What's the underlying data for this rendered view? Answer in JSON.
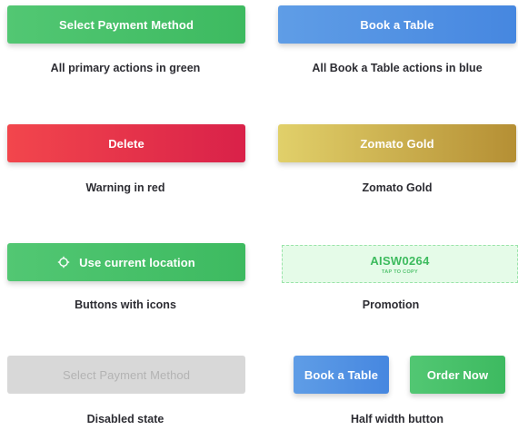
{
  "rows": [
    {
      "left_button": "Select Payment Method",
      "left_caption": "All primary actions in green",
      "right_button": "Book a Table",
      "right_caption": "All Book a Table actions in blue"
    },
    {
      "left_button": "Delete",
      "left_caption": "Warning in red",
      "right_button": "Zomato Gold",
      "right_caption": "Zomato Gold"
    },
    {
      "left_button": "Use current location",
      "left_icon": "location-target-icon",
      "left_caption": "Buttons with icons",
      "promo_code": "AISW0264",
      "promo_sub": "TAP TO COPY",
      "right_caption": "Promotion"
    },
    {
      "left_button": "Select Payment Method",
      "left_caption": "Disabled state",
      "half_left": "Book a Table",
      "half_right": "Order Now",
      "right_caption": "Half width button"
    }
  ],
  "colors": {
    "primary_green": "#3dba60",
    "book_blue": "#4687e0",
    "warning_red": "#d92149",
    "gold": "#b58f34",
    "disabled_gray": "#d8d8d8",
    "promo_bg": "#e5fbe8"
  }
}
